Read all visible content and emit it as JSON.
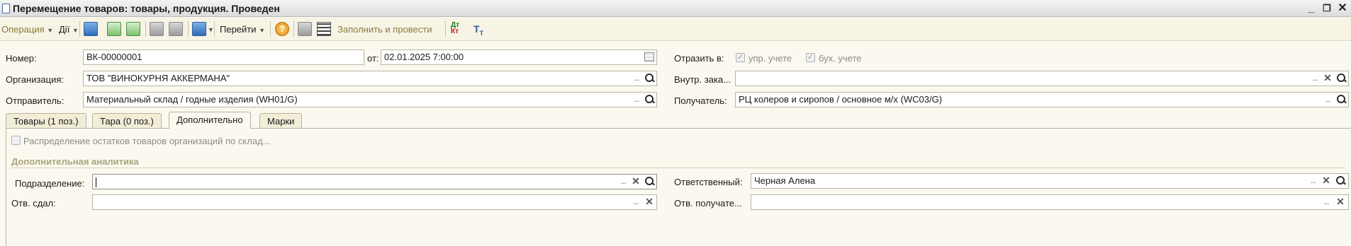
{
  "window": {
    "title": "Перемещение товаров: товары, продукция. Проведен",
    "controls": [
      "_",
      "❐",
      "✕"
    ]
  },
  "toolbar": {
    "operation_label": "Операция",
    "actions_label": "Дії",
    "goto_label": "Перейти",
    "fill_and_post_label": "Заполнить и провести",
    "help_glyph": "?"
  },
  "form": {
    "number_label": "Номер:",
    "number_value": "ВК-00000001",
    "date_label": "от:",
    "date_value": "02.01.2025  7:00:00",
    "reflect_label": "Отразить в:",
    "mgmt_accounting_label": "упр. учете",
    "accounting_label": "бух. учете",
    "organization_label": "Организация:",
    "organization_value": "ТОВ \"ВИНОКУРНЯ АККЕРМАНА\"",
    "internal_order_label": "Внутр. зака...",
    "internal_order_value": "",
    "sender_label": "Отправитель:",
    "sender_value": "Материальный склад / годные изделия (WH01/G)",
    "recipient_label": "Получатель:",
    "recipient_value": "РЦ колеров и сиропов / основное м/х (WC03/G)"
  },
  "tabs": [
    {
      "label": "Товары (1 поз.)"
    },
    {
      "label": "Тара (0 поз.)"
    },
    {
      "label": "Дополнительно"
    },
    {
      "label": "Марки"
    }
  ],
  "extra": {
    "distribution_checkbox_label": "Распределение остатков товаров организаций по склад...",
    "section_title": "Дополнительная аналитика",
    "department_label": "Подразделение:",
    "department_value": "",
    "responsible_label": "Ответственный:",
    "responsible_value": "Черная  Алена",
    "handed_over_label": "Отв. сдал:",
    "handed_over_value": "",
    "receiver_label": "Отв. получате...",
    "receiver_value": ""
  },
  "glyphs": {
    "dots": "...",
    "clear": "✕",
    "check": "✓"
  },
  "colors": {
    "background": "#fbf9ef",
    "toolbar_text": "#8a7a3c",
    "section_title": "#a9a37c"
  }
}
